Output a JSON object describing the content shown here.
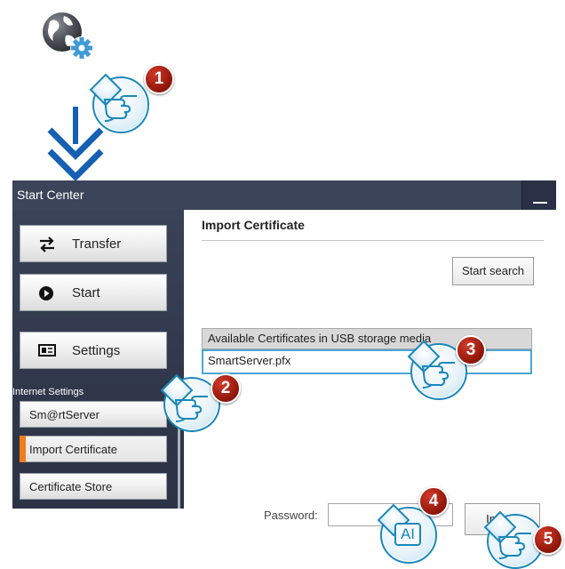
{
  "window": {
    "title": "Start Center"
  },
  "sidebar": {
    "buttons": [
      {
        "label": "Transfer",
        "icon": "transfer-arrows-icon"
      },
      {
        "label": "Start",
        "icon": "play-icon"
      },
      {
        "label": "Settings",
        "icon": "settings-panel-icon"
      }
    ],
    "section_label": "Internet Settings",
    "sub_items": [
      {
        "label": "Sm@rtServer"
      },
      {
        "label": "Import Certificate",
        "active": true
      },
      {
        "label": "Certificate Store"
      }
    ]
  },
  "content": {
    "title": "Import Certificate",
    "start_search_label": "Start search",
    "list_header": "Available Certificates in USB storage media",
    "list_items": [
      "SmartServer.pfx"
    ],
    "password_label": "Password:",
    "password_value": "",
    "import_label": "Import"
  },
  "callouts": {
    "step1": "1",
    "step2": "2",
    "step3": "3",
    "step4": "4",
    "step5": "5",
    "text_entry_icon_text": "AI"
  },
  "colors": {
    "titlebar": "#3c4459",
    "accent_orange": "#ef7d1a",
    "selection_blue": "#4aa6d6",
    "arrow_blue": "#1560b2",
    "badge_red": "#b3261b"
  }
}
